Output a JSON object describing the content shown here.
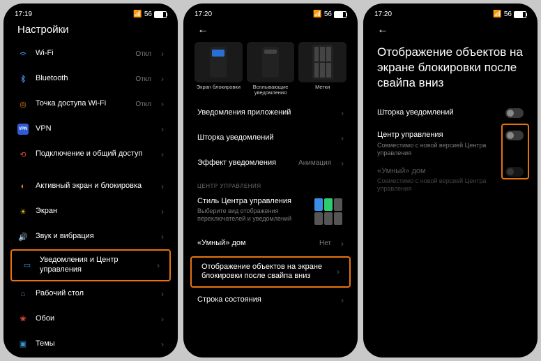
{
  "phone1": {
    "time": "17:19",
    "signal": "56",
    "title": "Настройки",
    "items": [
      {
        "label": "Wi-Fi",
        "value": "Откл"
      },
      {
        "label": "Bluetooth",
        "value": "Откл"
      },
      {
        "label": "Точка доступа Wi-Fi",
        "value": "Откл"
      },
      {
        "label": "VPN",
        "value": ""
      },
      {
        "label": "Подключение и общий доступ",
        "value": ""
      },
      {
        "label": "Активный экран и блокировка",
        "value": ""
      },
      {
        "label": "Экран",
        "value": ""
      },
      {
        "label": "Звук и вибрация",
        "value": ""
      },
      {
        "label": "Уведомления и Центр управления",
        "value": ""
      },
      {
        "label": "Рабочий стол",
        "value": ""
      },
      {
        "label": "Обои",
        "value": ""
      },
      {
        "label": "Темы",
        "value": ""
      }
    ]
  },
  "phone2": {
    "time": "17:20",
    "signal": "56",
    "thumbs": [
      {
        "label": "Экран блокировки"
      },
      {
        "label": "Всплывающие уведомления"
      },
      {
        "label": "Метки"
      }
    ],
    "items": [
      {
        "label": "Уведомления приложений"
      },
      {
        "label": "Шторка уведомлений"
      },
      {
        "label": "Эффект уведомления",
        "value": "Анимация"
      }
    ],
    "section_header": "ЦЕНТР УПРАВЛЕНИЯ",
    "cc_style": {
      "label": "Стиль Центра управления",
      "sub": "Выберите вид отображения переключателей и уведомлений"
    },
    "smart_home": {
      "label": "«Умный» дом",
      "value": "Нет"
    },
    "lock_display": {
      "label": "Отображение объектов на экране блокировки после свайпа вниз"
    },
    "status_line": {
      "label": "Cтрока состояния"
    }
  },
  "phone3": {
    "time": "17:20",
    "signal": "56",
    "title": "Отображение объектов на экране блокировки после свайпа вниз",
    "items": [
      {
        "label": "Шторка уведомлений"
      },
      {
        "label": "Центр управления",
        "sub": "Совместимо с новой версией Центра управления"
      },
      {
        "label": "«Умный» дом",
        "sub": "Совместимо с новой версией Центра управления"
      }
    ]
  }
}
